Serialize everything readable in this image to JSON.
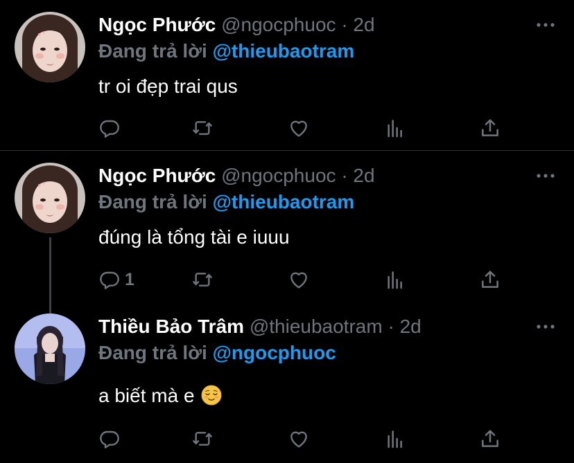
{
  "colors": {
    "background": "#000000",
    "text": "#ffffff",
    "muted": "#6e767d",
    "link": "#1d9bf0",
    "divider": "#2f3336"
  },
  "tweets": [
    {
      "display_name": "Ngọc Phước",
      "handle": "@ngocphuoc",
      "separator": "·",
      "time": "2d",
      "replying_prefix": "Đang trả lời",
      "replying_to": "@thieubaotram",
      "text": "tr oi đẹp trai qus",
      "reply_count": ""
    },
    {
      "display_name": "Ngọc Phước",
      "handle": "@ngocphuoc",
      "separator": "·",
      "time": "2d",
      "replying_prefix": "Đang trả lời",
      "replying_to": "@thieubaotram",
      "text": "đúng là tổng tài e iuuu",
      "reply_count": "1"
    },
    {
      "display_name": "Thiều Bảo Trâm",
      "handle": "@thieubaotram",
      "separator": "·",
      "time": "2d",
      "replying_prefix": "Đang trả lời",
      "replying_to": "@ngocphuoc",
      "text": "a biết mà e",
      "reply_count": ""
    }
  ],
  "icons": [
    "more-icon",
    "reply-icon",
    "retweet-icon",
    "like-icon",
    "stats-icon",
    "share-icon",
    "relieved-face-emoji"
  ]
}
